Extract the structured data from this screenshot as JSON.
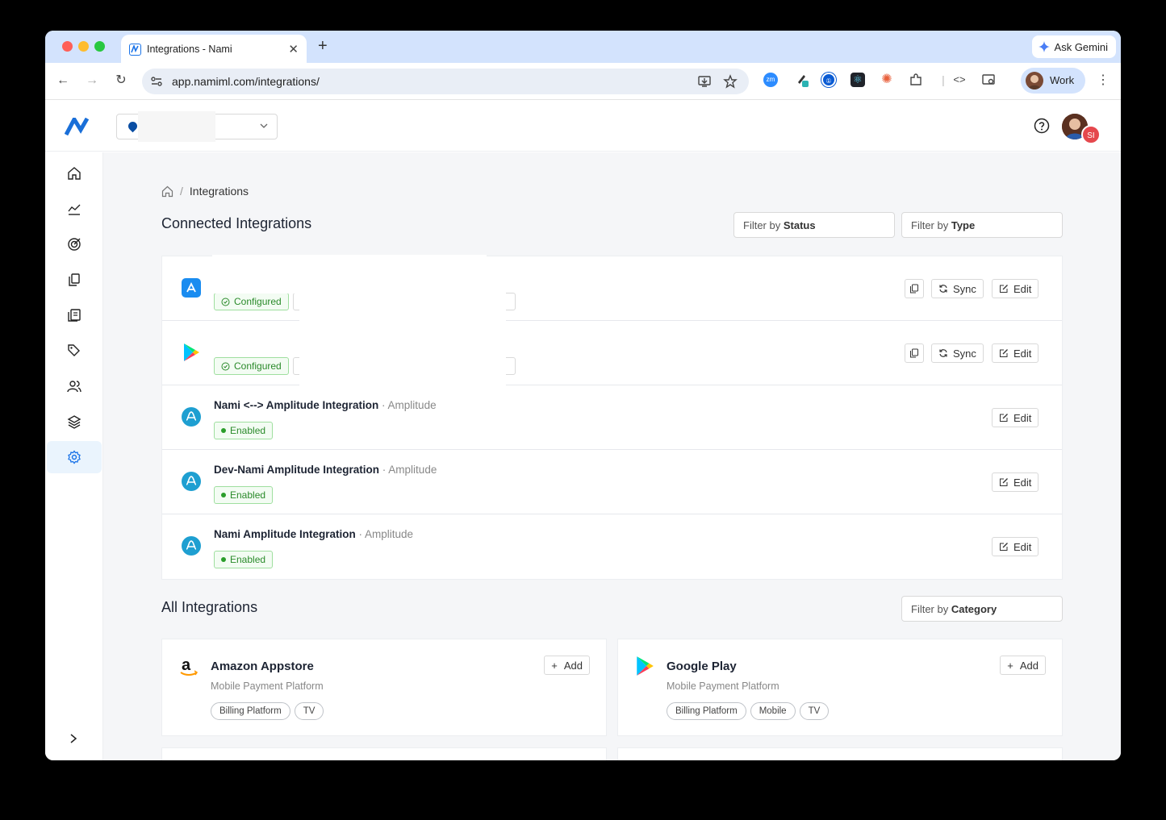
{
  "browser": {
    "tab_title": "Integrations - Nami",
    "url": "app.namiml.com/integrations/",
    "gemini_label": "Ask Gemini",
    "profile_label": "Work",
    "ext_zoom_label": "zm"
  },
  "header": {
    "user_initials": "SI"
  },
  "breadcrumb": {
    "current": "Integrations"
  },
  "connected": {
    "title": "Connected Integrations",
    "filter_status_prefix": "Filter by ",
    "filter_status_bold": "Status",
    "filter_type_prefix": "Filter by ",
    "filter_type_bold": "Type",
    "rows": [
      {
        "status": "Configured",
        "sync": "Sync",
        "edit": "Edit"
      },
      {
        "status": "Configured",
        "sync": "Sync",
        "edit": "Edit"
      },
      {
        "title": "Nami <--> Amplitude Integration",
        "sub": "· Amplitude",
        "status": "Enabled",
        "edit": "Edit"
      },
      {
        "title": "Dev-Nami Amplitude Integration",
        "sub": "· Amplitude",
        "status": "Enabled",
        "edit": "Edit"
      },
      {
        "title": "Nami Amplitude Integration",
        "sub": "· Amplitude",
        "status": "Enabled",
        "edit": "Edit"
      }
    ]
  },
  "all": {
    "title": "All Integrations",
    "filter_category_prefix": "Filter by ",
    "filter_category_bold": "Category",
    "cards": [
      {
        "name": "Amazon Appstore",
        "desc": "Mobile Payment Platform",
        "tags": [
          "Billing Platform",
          "TV"
        ],
        "add": "Add"
      },
      {
        "name": "Google Play",
        "desc": "Mobile Payment Platform",
        "tags": [
          "Billing Platform",
          "Mobile",
          "TV"
        ],
        "add": "Add"
      }
    ]
  },
  "colors": {
    "brand": "#1a73e8",
    "enabled_green": "#2a9d2a",
    "page_bg": "#f5f6f8"
  }
}
